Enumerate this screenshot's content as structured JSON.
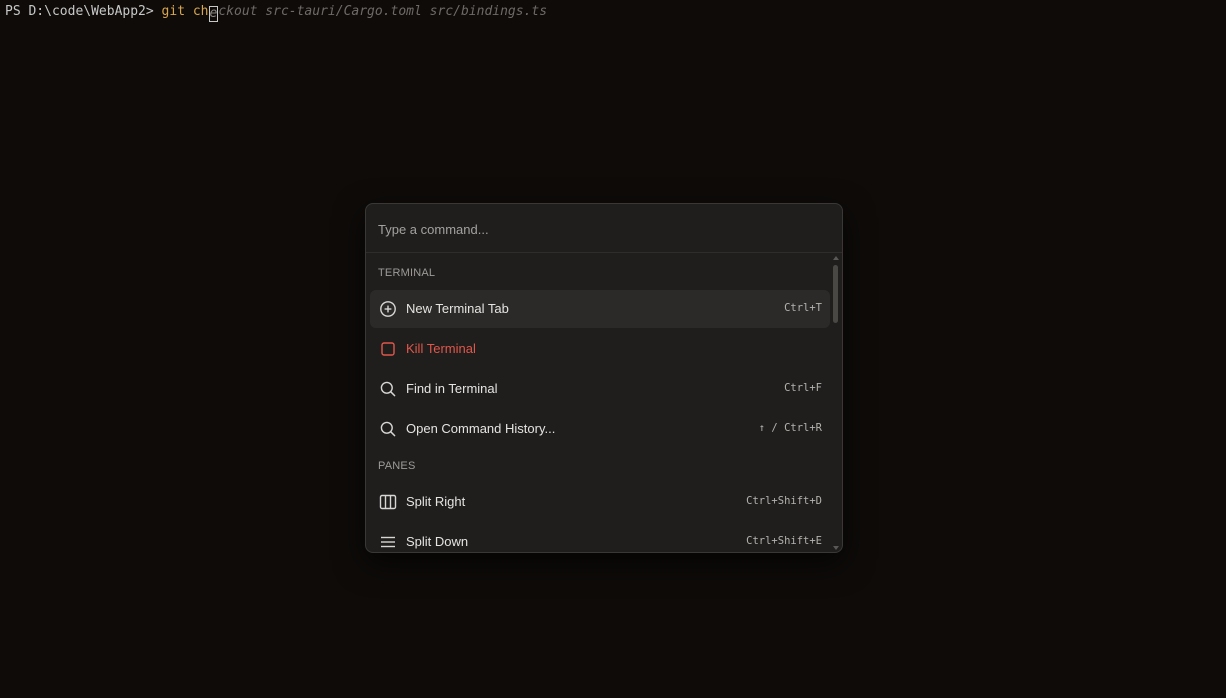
{
  "terminal": {
    "prompt": "PS D:\\code\\WebApp2> ",
    "typed_before_cursor": "git ch",
    "cursor_char": "e",
    "suggestion_rest": "ckout src-tauri/Cargo.toml src/bindings.ts"
  },
  "palette": {
    "search_placeholder": "Type a command...",
    "sections": [
      {
        "title": "TERMINAL",
        "items": [
          {
            "label": "New Terminal Tab",
            "shortcut": "Ctrl+T",
            "icon": "plus-circle-icon",
            "selected": true
          },
          {
            "label": "Kill Terminal",
            "shortcut": "",
            "icon": "square-icon",
            "danger": true
          },
          {
            "label": "Find in Terminal",
            "shortcut": "Ctrl+F",
            "icon": "search-icon"
          },
          {
            "label": "Open Command History...",
            "shortcut": "↑ / Ctrl+R",
            "icon": "search-icon"
          }
        ]
      },
      {
        "title": "PANES",
        "items": [
          {
            "label": "Split Right",
            "shortcut": "Ctrl+Shift+D",
            "icon": "columns-icon"
          },
          {
            "label": "Split Down",
            "shortcut": "Ctrl+Shift+E",
            "icon": "rows-icon"
          }
        ]
      }
    ]
  },
  "colors": {
    "background": "#0e0b09",
    "palette_bg": "#1f1e1d",
    "selected_bg": "#2b2a28",
    "command_color": "#d7a64e",
    "danger": "#e0574b"
  }
}
